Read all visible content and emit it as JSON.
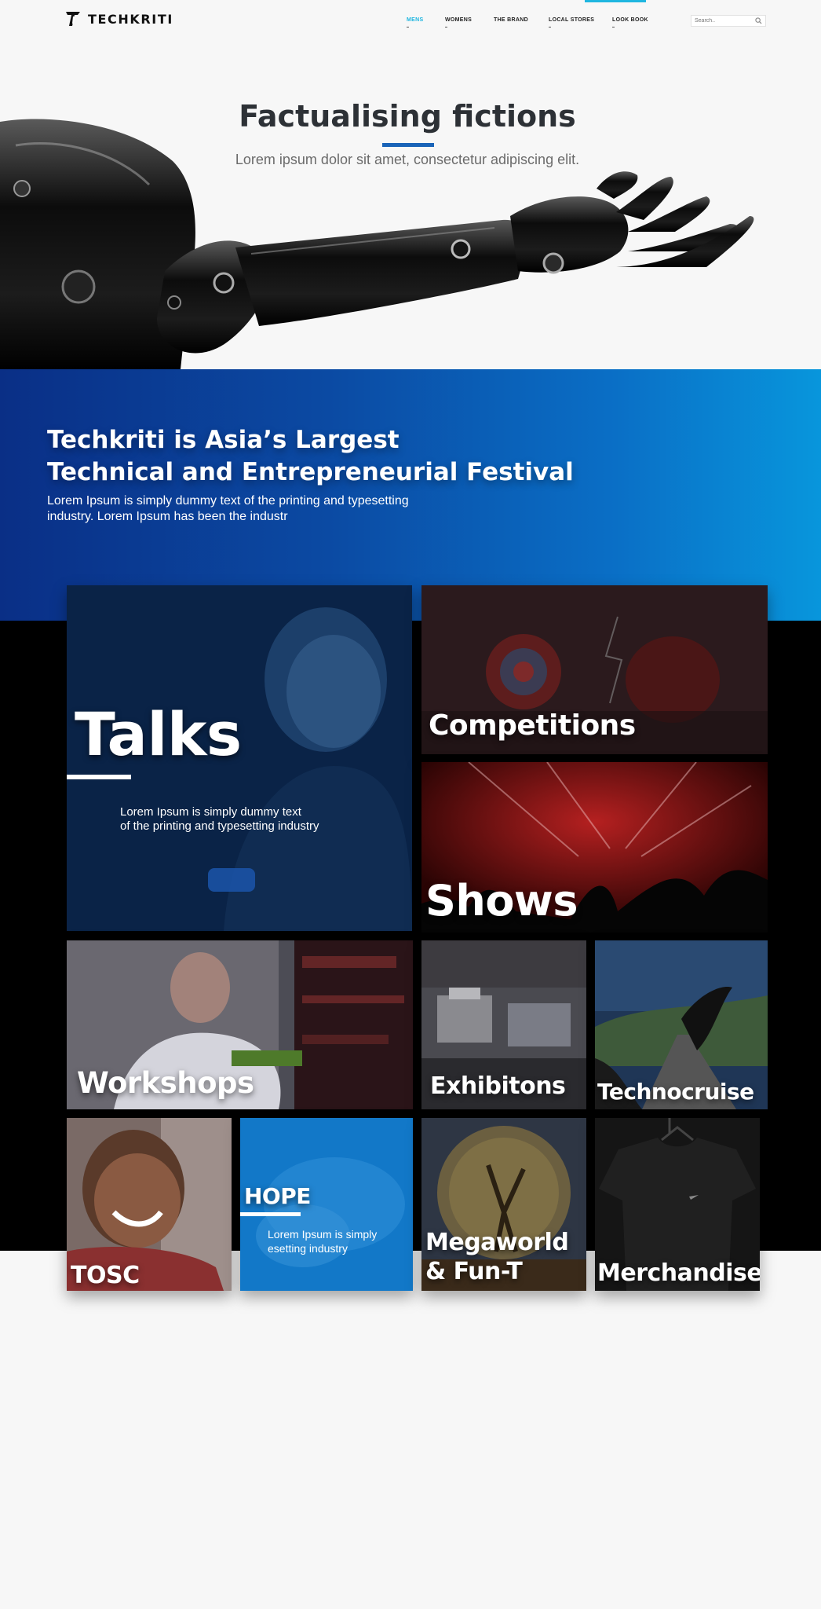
{
  "brand": {
    "name": "TECHKRITI",
    "logo_icon": "techkriti-logo-icon"
  },
  "nav": {
    "items": [
      {
        "label": "MENS",
        "active": true
      },
      {
        "label": "WOMENS",
        "active": false
      },
      {
        "label": "THE BRAND",
        "active": false
      },
      {
        "label": "LOCAL STORES",
        "active": false
      },
      {
        "label": "LOOK BOOK",
        "active": false
      }
    ],
    "accent_color": "#1fb6e0"
  },
  "search": {
    "placeholder": "Search..",
    "icon": "search-icon"
  },
  "hero": {
    "title": "Factualising fictions",
    "subtitle": "Lorem ipsum dolor sit amet, consectetur adipiscing elit.",
    "underline_color": "#1a64b8",
    "image": "robotic-arm"
  },
  "intro": {
    "title_line1": "Techkriti is Asia’s Largest",
    "title_line2": "Technical and Entrepreneurial Festival",
    "desc_line1": "Lorem Ipsum is simply dummy text of the printing and typesetting",
    "desc_line2": "industry. Lorem Ipsum has been the industr",
    "gradient": [
      "#0a2f86",
      "#0896dc"
    ]
  },
  "tiles": {
    "talks": {
      "label": "Talks",
      "desc_line1": "Lorem Ipsum is simply dummy text",
      "desc_line2": "of the printing and typesetting industry"
    },
    "competitions": {
      "label": "Competitions"
    },
    "shows": {
      "label": "Shows"
    },
    "workshops": {
      "label": "Workshops"
    },
    "exhibitions": {
      "label": "Exhibitons"
    },
    "technocruise": {
      "label": "Technocruise"
    },
    "tosc": {
      "label": "TOSC"
    },
    "hope": {
      "label": "HOPE",
      "desc_line1": "Lorem Ipsum is simply",
      "desc_line2": "esetting industry"
    },
    "megaworld": {
      "label_line1": "Megaworld",
      "label_line2": "& Fun-T"
    },
    "merchandise": {
      "label": "Merchandise"
    }
  }
}
